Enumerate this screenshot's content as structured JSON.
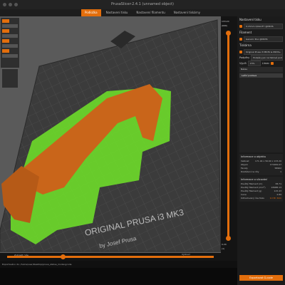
{
  "window": {
    "title": "PrusaSlicer-2.4.1 (unnamed object)"
  },
  "tabs": [
    {
      "label": "Podložka",
      "active": true
    },
    {
      "label": "Nastavení tisku",
      "active": false
    },
    {
      "label": "Nastavení filamentu",
      "active": false
    },
    {
      "label": "Nastavení tiskárny",
      "active": false
    }
  ],
  "viewport": {
    "bed_label": "ORIGINAL PRUSA i3 MK3",
    "bed_label2": "by Josef Prusa"
  },
  "layer_slider": {
    "top_value": "133.20",
    "top_layer": "(666)",
    "bottom_value": "0.20",
    "bottom_layer": "(1)"
  },
  "sidebar": {
    "print_settings_label": "Nastavení tisku",
    "print_profile": "0.15mm QUALITY @MK3S",
    "filament_label": "Filament",
    "filament_profile": "Generic PLA @MK3S",
    "printer_label": "Tiskárna",
    "printer_profile": "Original Prusa i3 MK3S & MK3S+",
    "supports_label": "Podpěry",
    "supports_value": "Podpěry jen na tiskové podložce",
    "infill_label": "Výplň",
    "infill_value": "15%",
    "brim_label": "Límec",
    "object_list_header": "Název",
    "object_name": "Ležící postava",
    "info_title": "Informace o objektu",
    "info_rows": [
      {
        "k": "Velikost",
        "v": "171.94 x 56.60 x 133.20"
      },
      {
        "k": "Objem",
        "v": "170184.07"
      },
      {
        "k": "Facety",
        "v": "58962"
      },
      {
        "k": "Rozdělení na díly",
        "v": "1"
      }
    ],
    "sliced_title": "Informace o slicování",
    "sliced_rows": [
      {
        "k": "Použitý filament (m)",
        "v": "38.71"
      },
      {
        "k": "Použitý filament (mm³)",
        "v": "93088.13"
      },
      {
        "k": "Použitý filament (g)",
        "v": "115.43"
      },
      {
        "k": "Cena",
        "v": "2.89"
      },
      {
        "k": "Odhadovaný čas tisku",
        "v": "1d 3h 32m"
      }
    ],
    "export_button": "Exportovat G-code"
  },
  "bottom_bar": {
    "slider_left": "Zobrazit: Vše",
    "slider_right": "Výchozí"
  },
  "status": {
    "text": "Exportováno do: /home/user/Desktop/prusa_statue_model.gcode"
  }
}
